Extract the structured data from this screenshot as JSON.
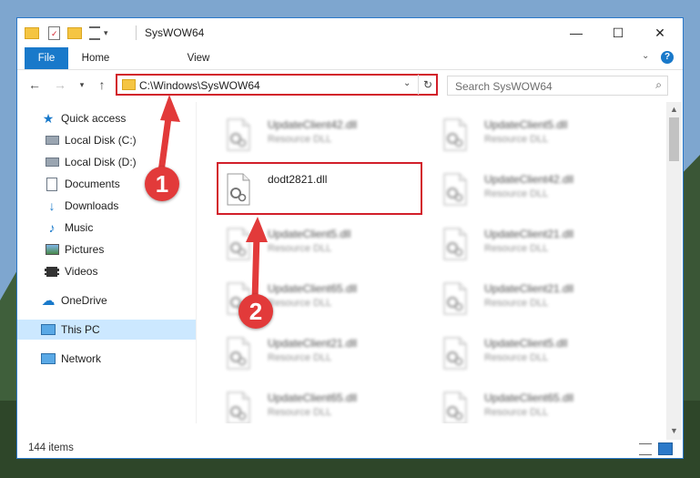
{
  "window": {
    "title": "SysWOW64",
    "minimize_glyph": "—",
    "maximize_glyph": "☐",
    "close_glyph": "✕"
  },
  "ribbon": {
    "tabs": [
      "File",
      "Home",
      "View"
    ]
  },
  "address": {
    "path": "C:\\Windows\\SysWOW64"
  },
  "search": {
    "placeholder": "Search SysWOW64"
  },
  "nav": {
    "quick_access": "Quick access",
    "items": [
      "Local Disk (C:)",
      "Local Disk (D:)",
      "Documents",
      "Downloads",
      "Music",
      "Pictures",
      "Videos"
    ],
    "onedrive": "OneDrive",
    "this_pc": "This PC",
    "network": "Network"
  },
  "files": [
    {
      "name": "UpdateClient42.dll",
      "desc": "Resource DLL"
    },
    {
      "name": "UpdateClient5.dll",
      "desc": "Resource DLL"
    },
    {
      "name": "dodt2821.dll",
      "desc": ""
    },
    {
      "name": "UpdateClient42.dll",
      "desc": "Resource DLL"
    },
    {
      "name": "UpdateClient5.dll",
      "desc": "Resource DLL"
    },
    {
      "name": "UpdateClient21.dll",
      "desc": "Resource DLL"
    },
    {
      "name": "UpdateClient65.dll",
      "desc": "Resource DLL"
    },
    {
      "name": "UpdateClient21.dll",
      "desc": "Resource DLL"
    },
    {
      "name": "UpdateClient21.dll",
      "desc": "Resource DLL"
    },
    {
      "name": "UpdateClient5.dll",
      "desc": "Resource DLL"
    },
    {
      "name": "UpdateClient65.dll",
      "desc": "Resource DLL"
    },
    {
      "name": "UpdateClient65.dll",
      "desc": "Resource DLL"
    }
  ],
  "status": {
    "count": "144 items"
  },
  "annotations": {
    "step1": "1",
    "step2": "2",
    "color": "#e23a3a"
  },
  "colors": {
    "accent": "#1979ca",
    "highlight": "#d21f2a",
    "selection": "#cce8ff"
  }
}
